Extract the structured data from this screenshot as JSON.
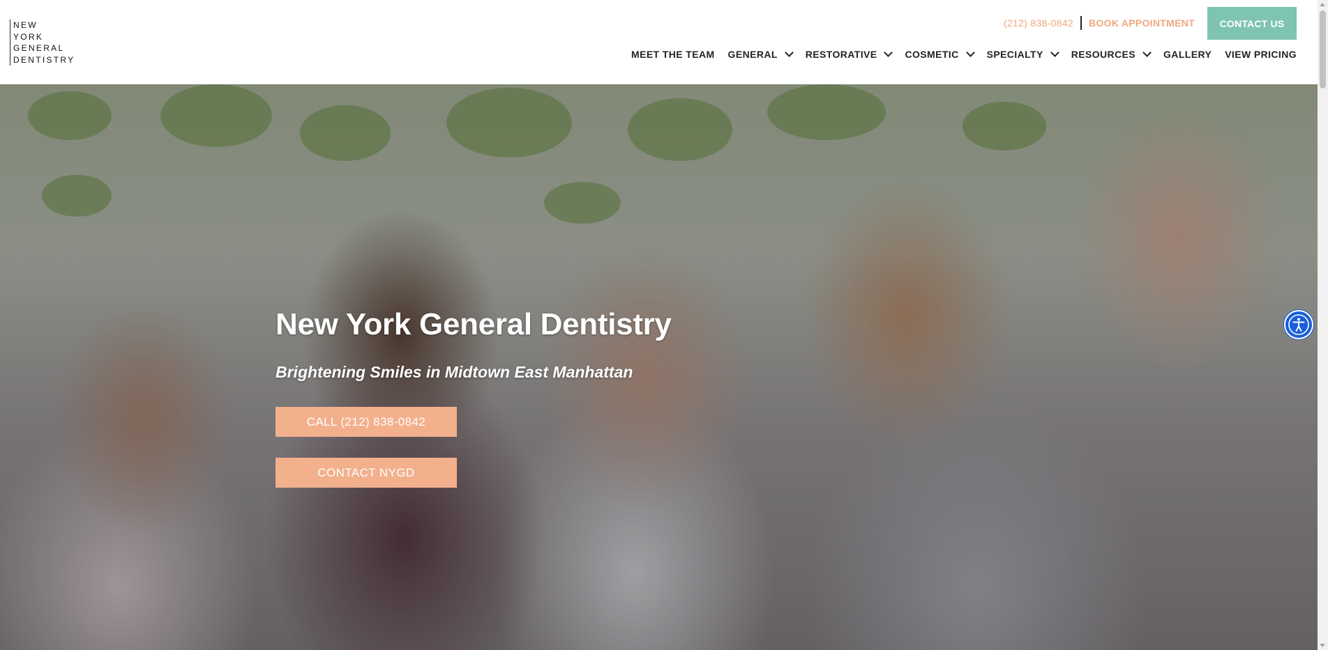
{
  "logo": {
    "lines": [
      "NEW",
      "YORK",
      "GENERAL",
      "DENTISTRY"
    ]
  },
  "header": {
    "phone": "(212) 838-0842",
    "book_label": "BOOK APPOINTMENT",
    "contact_label": "CONTACT US"
  },
  "nav": {
    "items": [
      {
        "label": "MEET THE TEAM"
      },
      {
        "label": "GENERAL"
      },
      {
        "label": "RESTORATIVE"
      },
      {
        "label": "COSMETIC"
      },
      {
        "label": "SPECIALTY"
      },
      {
        "label": "RESOURCES"
      },
      {
        "label": "GALLERY"
      },
      {
        "label": "VIEW PRICING"
      }
    ]
  },
  "hero": {
    "title": "New York General Dentistry",
    "subtitle": "Brightening Smiles in Midtown East Manhattan",
    "call_button": "CALL (212) 838-0842",
    "contact_button": "CONTACT NYGD"
  },
  "colors": {
    "accent_peach": "#f3b08d",
    "accent_teal": "#7ec4b1",
    "link_peach": "#f0a77c",
    "a11y_blue": "#1a5ed8"
  },
  "icons": {
    "accessibility": "accessibility-icon",
    "dropdown": "chevron-down-icon"
  }
}
